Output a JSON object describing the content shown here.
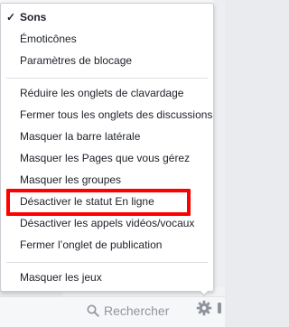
{
  "menu": {
    "group1": [
      {
        "label": "Sons",
        "checked": true
      },
      {
        "label": "Émoticônes"
      },
      {
        "label": "Paramètres de blocage"
      }
    ],
    "group2": [
      {
        "label": "Réduire les onglets de clavardage"
      },
      {
        "label": "Fermer tous les onglets des discussions"
      },
      {
        "label": "Masquer la barre latérale"
      },
      {
        "label": "Masquer les Pages que vous gérez"
      },
      {
        "label": "Masquer les groupes"
      },
      {
        "label": "Désactiver le statut En ligne",
        "highlighted": true,
        "highlight_color": "#ff0000"
      },
      {
        "label": "Désactiver les appels vidéos/vocaux"
      },
      {
        "label": "Fermer l’onglet de publication"
      }
    ],
    "group3": [
      {
        "label": "Masquer les jeux"
      }
    ],
    "check_mark": "✓"
  },
  "footer": {
    "search_placeholder": "Rechercher",
    "search_icon": "search-icon",
    "settings_icon": "gear-icon"
  }
}
